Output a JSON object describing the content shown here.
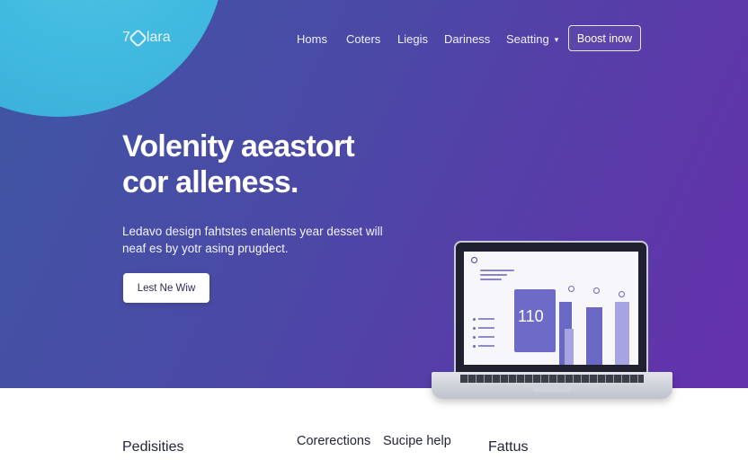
{
  "brand": {
    "name": "7Oolara",
    "prefix": "7",
    "suffix": "lara"
  },
  "nav": {
    "items": [
      {
        "label": "Homs"
      },
      {
        "label": "Coters"
      },
      {
        "label": "Liegis"
      },
      {
        "label": "Dariness"
      },
      {
        "label": "Seatting"
      }
    ],
    "cta_label": "Boost inow"
  },
  "hero": {
    "headline": "Volenity aeastort cor alleness.",
    "subtext": "Ledavo design fahtstes enalents year desset will neaf es by yotr asing prugdect.",
    "button_label": "Lest Ne Wiw"
  },
  "laptop_screen": {
    "stat_value": "110"
  },
  "features": [
    {
      "label": "Pedisities"
    },
    {
      "label": "Corerections"
    },
    {
      "label": "Sucipe help"
    },
    {
      "label": "Fattus"
    }
  ],
  "colors": {
    "hero_gradient_start": "#3f56a3",
    "hero_gradient_end": "#6531ad",
    "accent_blob": "#3eb6de",
    "button_bg": "#ffffff"
  }
}
